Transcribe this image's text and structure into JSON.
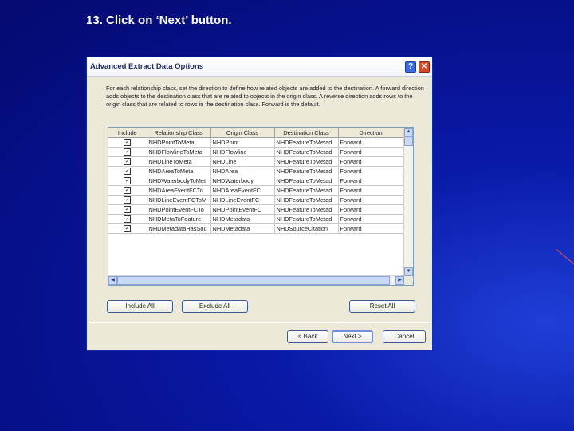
{
  "slide": {
    "title": "13.  Click on ‘Next’ button."
  },
  "dialog": {
    "title": "Advanced Extract Data Options",
    "help_glyph": "?",
    "close_glyph": "✕",
    "description": "For each relationship class, set the direction to define how related objects are added to the destination. A forward direction adds objects to the destination class that are related to objects in the origin class. A reverse direction adds rows to the origin class that are related to rows in the destination class. Forward is the default.",
    "columns": [
      "Include",
      "Relationship Class",
      "Origin Class",
      "Destination Class",
      "Direction"
    ],
    "rows": [
      {
        "include": true,
        "relationship": "NHDPointToMeta",
        "origin": "NHDPoint",
        "destination": "NHDFeatureToMetad",
        "direction": "Forward"
      },
      {
        "include": true,
        "relationship": "NHDFlowlineToMeta",
        "origin": "NHDFlowline",
        "destination": "NHDFeatureToMetad",
        "direction": "Forward"
      },
      {
        "include": true,
        "relationship": "NHDLineToMeta",
        "origin": "NHDLine",
        "destination": "NHDFeatureToMetad",
        "direction": "Forward"
      },
      {
        "include": true,
        "relationship": "NHDAreaToMeta",
        "origin": "NHDArea",
        "destination": "NHDFeatureToMetad",
        "direction": "Forward"
      },
      {
        "include": true,
        "relationship": "NHDWaterbodyToMet",
        "origin": "NHDWaterbody",
        "destination": "NHDFeatureToMetad",
        "direction": "Forward"
      },
      {
        "include": true,
        "relationship": "NHDAreaEventFCTo",
        "origin": "NHDAreaEventFC",
        "destination": "NHDFeatureToMetad",
        "direction": "Forward"
      },
      {
        "include": true,
        "relationship": "NHDLineEventFCToM",
        "origin": "NHDLineEventFC",
        "destination": "NHDFeatureToMetad",
        "direction": "Forward"
      },
      {
        "include": true,
        "relationship": "NHDPointEventFCTo",
        "origin": "NHDPointEventFC",
        "destination": "NHDFeatureToMetad",
        "direction": "Forward"
      },
      {
        "include": true,
        "relationship": "NHDMetaToFeature",
        "origin": "NHDMetadata",
        "destination": "NHDFeatureToMetad",
        "direction": "Forward"
      },
      {
        "include": true,
        "relationship": "NHDMetadataHasSou",
        "origin": "NHDMetadata",
        "destination": "NHDSourceCitation",
        "direction": "Forward"
      }
    ],
    "buttons": {
      "include_all": "Include All",
      "exclude_all": "Exclude All",
      "reset_all": "Reset All",
      "back": "< Back",
      "next": "Next >",
      "cancel": "Cancel"
    }
  }
}
